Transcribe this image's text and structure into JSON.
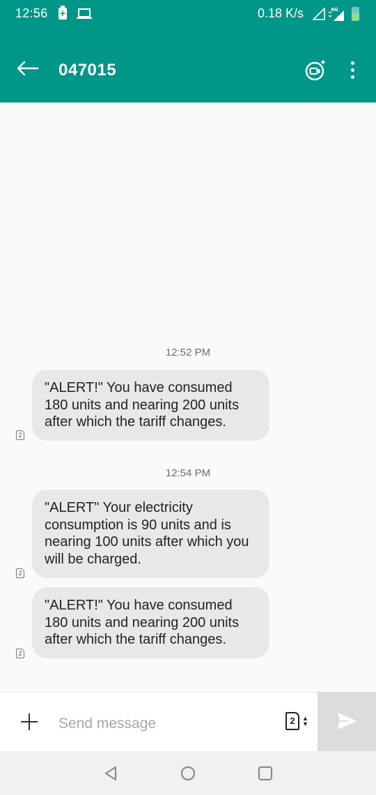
{
  "status_bar": {
    "time": "12:56",
    "net_speed": "0.18 K/s",
    "network_type": "4G",
    "battery_level": 0.55,
    "icons": [
      "battery-saver-icon",
      "laptop-icon",
      "wifi-signal-icon",
      "cell-signal-icon",
      "battery-icon"
    ]
  },
  "app_bar": {
    "title": "047015",
    "icons": [
      "back-arrow-icon",
      "video-call-icon",
      "more-vert-icon"
    ],
    "color": "#009688"
  },
  "conversation": {
    "groups": [
      {
        "timestamp": "12:52 PM",
        "messages": [
          {
            "text": "\"ALERT!\" You have consumed 180 units and nearing 200 units after which the tariff changes.",
            "sim": "2"
          }
        ]
      },
      {
        "timestamp": "12:54 PM",
        "messages": [
          {
            "text": "\"ALERT\" Your electricity consumption is 90 units and is nearing 100 units after which you will be charged.",
            "sim": "2"
          },
          {
            "text": "\"ALERT!\" You have consumed 180 units and nearing 200 units after which the tariff changes.",
            "sim": "2"
          }
        ]
      }
    ]
  },
  "composer": {
    "placeholder": "Send message",
    "value": "",
    "sim_selected": "2",
    "icons": [
      "add-icon",
      "sim-select-icon",
      "send-icon"
    ]
  },
  "nav_bar": {
    "icons": [
      "back-triangle-icon",
      "home-circle-icon",
      "recents-square-icon"
    ]
  }
}
